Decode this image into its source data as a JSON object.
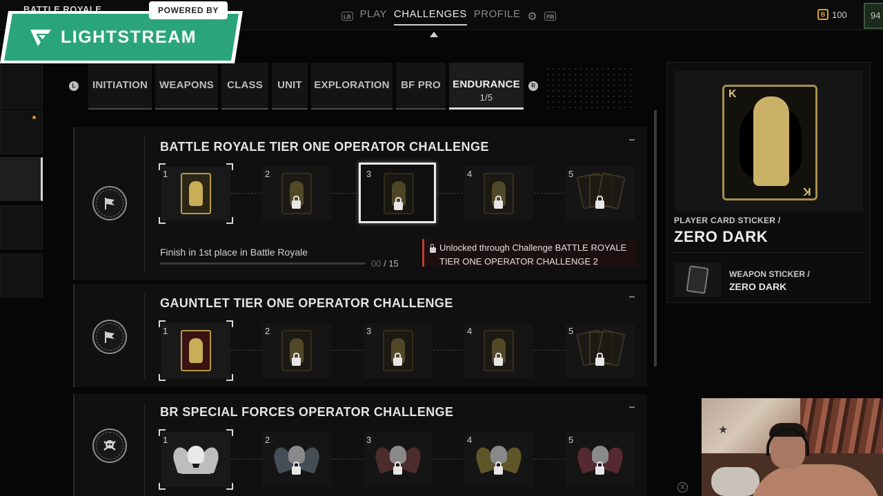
{
  "header": {
    "mode_title": "BATTLE ROYALE",
    "nav_left_hint": "LB",
    "nav_right_hint": "RB",
    "nav_items": [
      "PLAY",
      "CHALLENGES",
      "PROFILE"
    ],
    "active_nav": "CHALLENGES",
    "currency_icon_text": "B",
    "currency_amount": "100",
    "level_partial": "94"
  },
  "overlay": {
    "powered_by": "POWERED BY",
    "brand": "LIGHTSTREAM",
    "brand_color": "#2aa57b"
  },
  "category_tabs": {
    "left_hint": "L",
    "right_hint": "R",
    "items": [
      {
        "label": "INITIATION"
      },
      {
        "label": "WEAPONS"
      },
      {
        "label": "CLASS"
      },
      {
        "label": "UNIT"
      },
      {
        "label": "EXPLORATION"
      },
      {
        "label": "BF PRO"
      },
      {
        "label": "ENDURANCE",
        "count": "1/5",
        "active": true
      }
    ]
  },
  "challenges": [
    {
      "title": "BATTLE ROYALE TIER ONE OPERATOR CHALLENGE",
      "emblem_icon": "flag-icon",
      "tiers": [
        {
          "num": "1",
          "state": "unlocked"
        },
        {
          "num": "2",
          "state": "locked"
        },
        {
          "num": "3",
          "state": "locked",
          "selected": true
        },
        {
          "num": "4",
          "state": "locked"
        },
        {
          "num": "5",
          "state": "locked"
        }
      ],
      "objective": "Finish in 1st place in Battle Royale",
      "progress_current": "00",
      "progress_sep": " / ",
      "progress_total": "15",
      "progress_fraction": 0,
      "unlock_note": "Unlocked through Challenge BATTLE ROYALE TIER ONE OPERATOR CHALLENGE 2"
    },
    {
      "title": "GAUNTLET TIER ONE OPERATOR CHALLENGE",
      "emblem_icon": "flag-icon",
      "tiers": [
        {
          "num": "1",
          "state": "unlocked"
        },
        {
          "num": "2",
          "state": "locked"
        },
        {
          "num": "3",
          "state": "locked"
        },
        {
          "num": "4",
          "state": "locked"
        },
        {
          "num": "5",
          "state": "locked"
        }
      ]
    },
    {
      "title": "BR SPECIAL FORCES OPERATOR CHALLENGE",
      "emblem_icon": "skull-crossbones-icon",
      "tiers": [
        {
          "num": "1",
          "state": "unlocked",
          "color": "#bdbdbd"
        },
        {
          "num": "2",
          "state": "locked",
          "color": "#6d7c8c"
        },
        {
          "num": "3",
          "state": "locked",
          "color": "#7a4040"
        },
        {
          "num": "4",
          "state": "locked",
          "color": "#9a8a3a"
        },
        {
          "num": "5",
          "state": "locked",
          "color": "#8a3a48"
        }
      ]
    }
  ],
  "reward": {
    "type": "PLAYER CARD STICKER /",
    "name": "ZERO DARK",
    "card_rank": "K",
    "secondary_type": "WEAPON STICKER /",
    "secondary_name": "ZERO DARK"
  },
  "footer": {
    "x_hint": "X"
  }
}
